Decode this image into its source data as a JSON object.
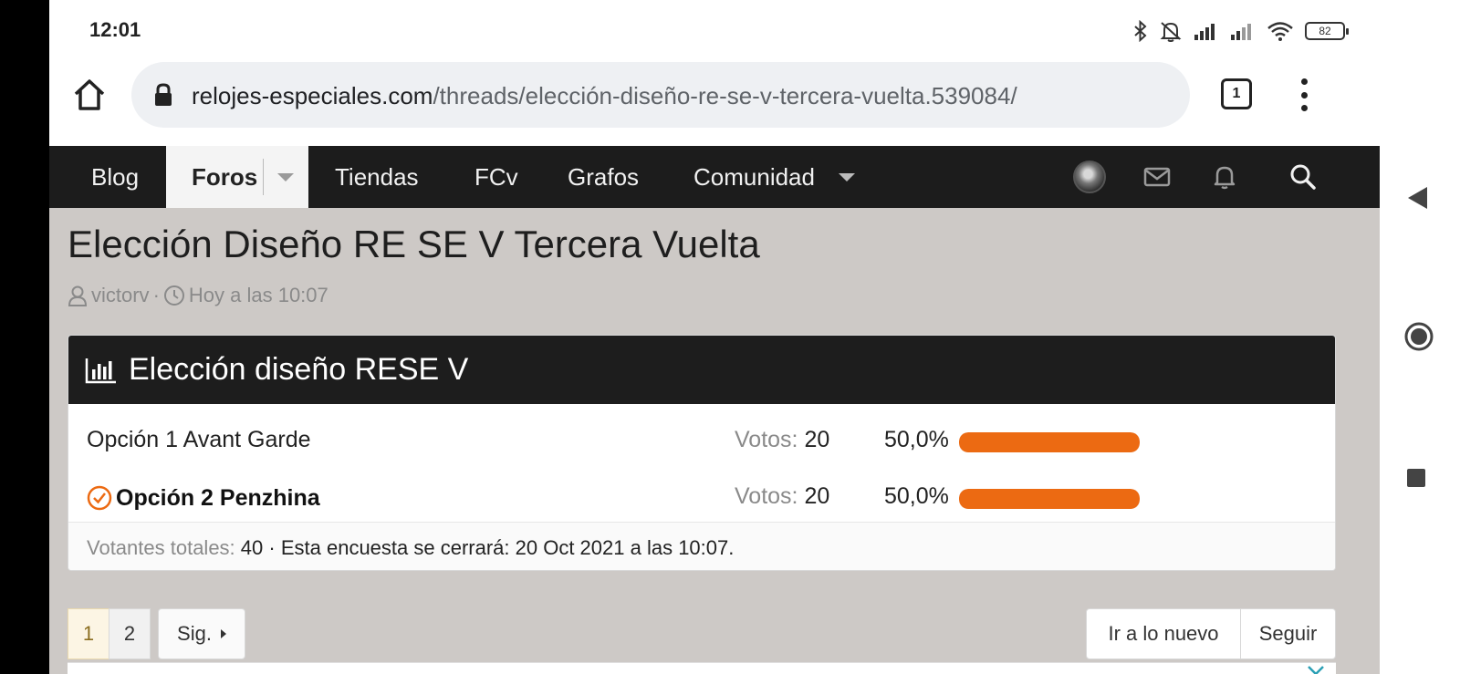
{
  "status_bar": {
    "time": "12:01",
    "battery": "82"
  },
  "browser": {
    "url_domain": "relojes-especiales.com",
    "url_path": "/threads/elección-diseño-re-se-v-tercera-vuelta.539084/",
    "tab_count": "1"
  },
  "nav": {
    "items": [
      {
        "label": "Blog"
      },
      {
        "label": "Foros"
      },
      {
        "label": "Tiendas"
      },
      {
        "label": "FCv"
      },
      {
        "label": "Grafos"
      },
      {
        "label": "Comunidad"
      }
    ]
  },
  "thread": {
    "title": "Elección Diseño RE SE V Tercera Vuelta",
    "author": "victorv",
    "separator": "·",
    "date": "Hoy a las 10:07"
  },
  "poll": {
    "title": "Elección diseño RESE V",
    "votes_label": "Votos:",
    "options": [
      {
        "label": "Opción 1 Avant Garde",
        "votes": "20",
        "percent": "50,0%",
        "fraction": 1.0,
        "chosen": false
      },
      {
        "label": "Opción 2 Penzhina",
        "votes": "20",
        "percent": "50,0%",
        "fraction": 1.0,
        "chosen": true
      }
    ],
    "footer": {
      "total_label": "Votantes totales:",
      "total": "40",
      "close_text": "· Esta encuesta se cerrará: 20 Oct 2021 a las 10:07."
    }
  },
  "pagination": {
    "page1": "1",
    "page2": "2",
    "next": "Sig.",
    "current_page": 1
  },
  "actions": {
    "new": "Ir a lo nuevo",
    "follow": "Seguir"
  },
  "colors": {
    "accent": "#ec6a12",
    "nav_bg": "#1c1c1c",
    "page_bg": "#cdc9c6"
  }
}
